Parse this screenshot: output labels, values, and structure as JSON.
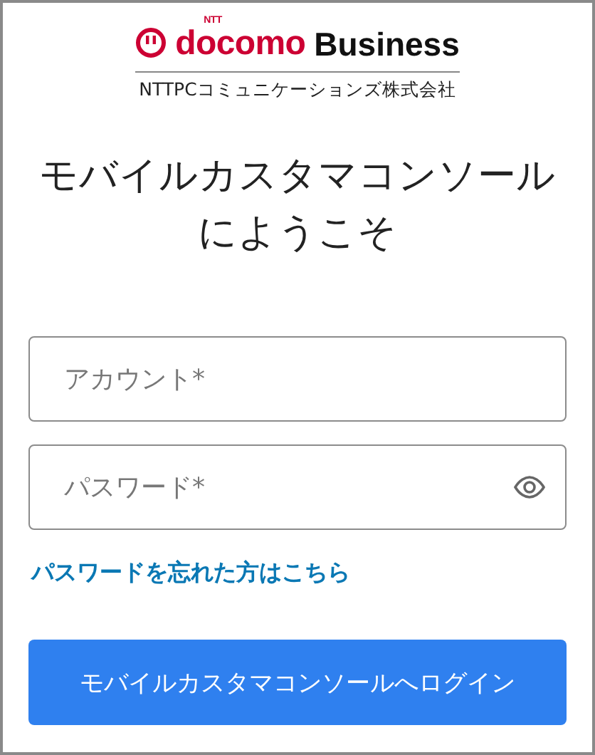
{
  "logo": {
    "small": "NTT",
    "brand": "docomo",
    "suffix": "Business"
  },
  "company": "NTTPCコミュニケーションズ株式会社",
  "heading": [
    "モバイルカスタマコンソール",
    "にようこそ"
  ],
  "fields": [
    {
      "kind": "text",
      "placeholder": "アカウント*"
    },
    {
      "kind": "password",
      "placeholder": "パスワード*"
    }
  ],
  "forgot_link": "パスワードを忘れた方はこちら",
  "login_button": "モバイルカスタマコンソールへログイン"
}
